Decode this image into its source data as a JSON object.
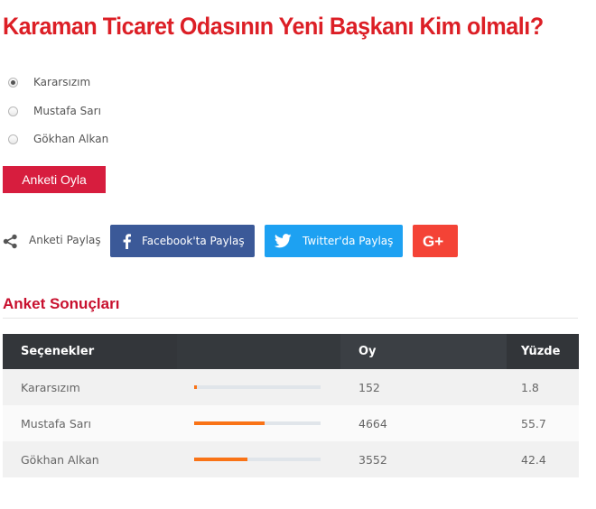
{
  "poll": {
    "title": "Karaman Ticaret Odasının Yeni Başkanı Kim olmalı?",
    "title_color": "#dc1f26",
    "options": [
      {
        "label": "Kararsızım",
        "selected": true
      },
      {
        "label": "Mustafa Sarı",
        "selected": false
      },
      {
        "label": "Gökhan Alkan",
        "selected": false
      }
    ],
    "vote_button": "Anketi Oyla",
    "vote_button_color": "#d71d3e"
  },
  "share": {
    "icon": "share-icon",
    "label": "Anketi Paylaş",
    "facebook": {
      "label": "Facebook'ta Paylaş",
      "icon": "facebook-icon",
      "color": "#3b5998"
    },
    "twitter": {
      "label": "Twitter'da Paylaş",
      "icon": "twitter-icon",
      "color": "#1da1f2"
    },
    "googleplus": {
      "label": "G+",
      "icon": "google-plus-icon",
      "color": "#f44336"
    }
  },
  "results": {
    "heading": "Anket Sonuçları",
    "heading_color": "#c8102e",
    "bar_color": "#f97316",
    "headers": {
      "option": "Seçenekler",
      "bar": "",
      "votes": "Oy",
      "percent": "Yüzde"
    },
    "rows": [
      {
        "option": "Kararsızım",
        "votes": "152",
        "percent": "1.8",
        "percent_value": 1.8
      },
      {
        "option": "Mustafa Sarı",
        "votes": "4664",
        "percent": "55.7",
        "percent_value": 55.7
      },
      {
        "option": "Gökhan Alkan",
        "votes": "3552",
        "percent": "42.4",
        "percent_value": 42.4
      }
    ]
  }
}
